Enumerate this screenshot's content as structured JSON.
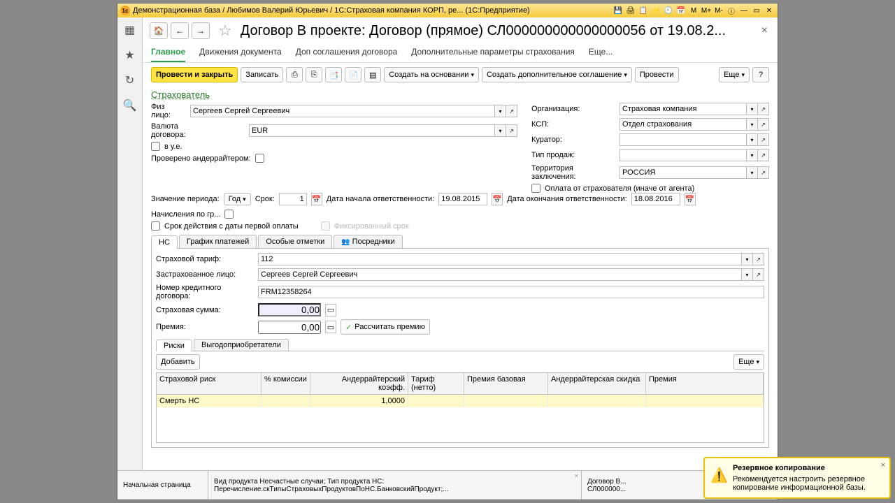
{
  "titlebar": {
    "text": "Демонстрационная база / Любимов Валерий Юрьевич / 1С:Страховая компания КОРП, ре...  (1С:Предприятие)"
  },
  "header": {
    "title": "Договор В проекте: Договор (прямое) СЛ000000000000000056 от 19.08.2..."
  },
  "mainTabs": [
    "Главное",
    "Движения документа",
    "Доп соглашения договора",
    "Дополнительные параметры страхования",
    "Еще..."
  ],
  "toolbar": {
    "postClose": "Провести и закрыть",
    "write": "Записать",
    "createBased": "Создать на основании",
    "createAddon": "Создать дополнительное соглашение",
    "post": "Провести",
    "more": "Еще",
    "help": "?"
  },
  "section": "Страхователь",
  "left": {
    "fizlico_lbl": "Физ лицо:",
    "fizlico": "Сергеев Сергей Сергеевич",
    "currency_lbl": "Валюта договора:",
    "currency": "EUR",
    "vue_lbl": "в у.е.",
    "underwriter_lbl": "Проверено андеррайтером:"
  },
  "right": {
    "org_lbl": "Организация:",
    "org": "Страховая компания",
    "ksp_lbl": "КСП:",
    "ksp": "Отдел страхования",
    "curator_lbl": "Куратор:",
    "curator": "",
    "saletype_lbl": "Тип продаж:",
    "saletype": "",
    "territory_lbl": "Территория заключения:",
    "territory": "РОССИЯ",
    "pay_lbl": "Оплата от страхователя (иначе от агента)"
  },
  "period": {
    "val_lbl": "Значение периода:",
    "unit": "Год",
    "term_lbl": "Срок:",
    "term": "1",
    "start_lbl": "Дата начала ответственности:",
    "start": "19.08.2015",
    "end_lbl": "Дата окончания ответственности:",
    "end": "18.08.2016",
    "accr_lbl": "Начисления по гр...",
    "fromfirst_lbl": "Срок действия с даты первой оплаты",
    "fixed_lbl": "Фиксированный срок"
  },
  "innerTabs": [
    "НС",
    "График платежей",
    "Особые отметки",
    "Посредники"
  ],
  "ns": {
    "tarif_lbl": "Страховой тариф:",
    "tarif": "112",
    "insured_lbl": "Застрахованное лицо:",
    "insured": "Сергеев Сергей Сергеевич",
    "credit_lbl": "Номер кредитного договора:",
    "credit": "FRM12358264",
    "sum_lbl": "Страховая сумма:",
    "sum": "0,00",
    "prem_lbl": "Премия:",
    "prem": "0,00",
    "calc": "Рассчитать премию"
  },
  "subTabs": [
    "Риски",
    "Выгодоприобретатели"
  ],
  "riskToolbar": {
    "add": "Добавить",
    "more": "Еще"
  },
  "table": {
    "headers": [
      "Страховой риск",
      "% комиссии",
      "Андеррайтерский коэфф.",
      "Тариф (нетто)",
      "Премия базовая",
      "Андеррайтерская скидка",
      "Премия"
    ],
    "row": {
      "risk": "Смерть НС",
      "coef": "1,0000"
    }
  },
  "bottomTabs": {
    "t1": "Начальная страница",
    "t2a": "Вид продукта Несчастные случаи; Тип продукта НС:",
    "t2b": "Перечисление.скТипыСтраховыхПродуктовПоНС.БанковскийПродукт;...",
    "t3a": "Договор В...",
    "t3b": "СЛ000000..."
  },
  "toast": {
    "title": "Резервное копирование",
    "body": "Рекомендуется настроить резервное копирование информационной базы."
  }
}
